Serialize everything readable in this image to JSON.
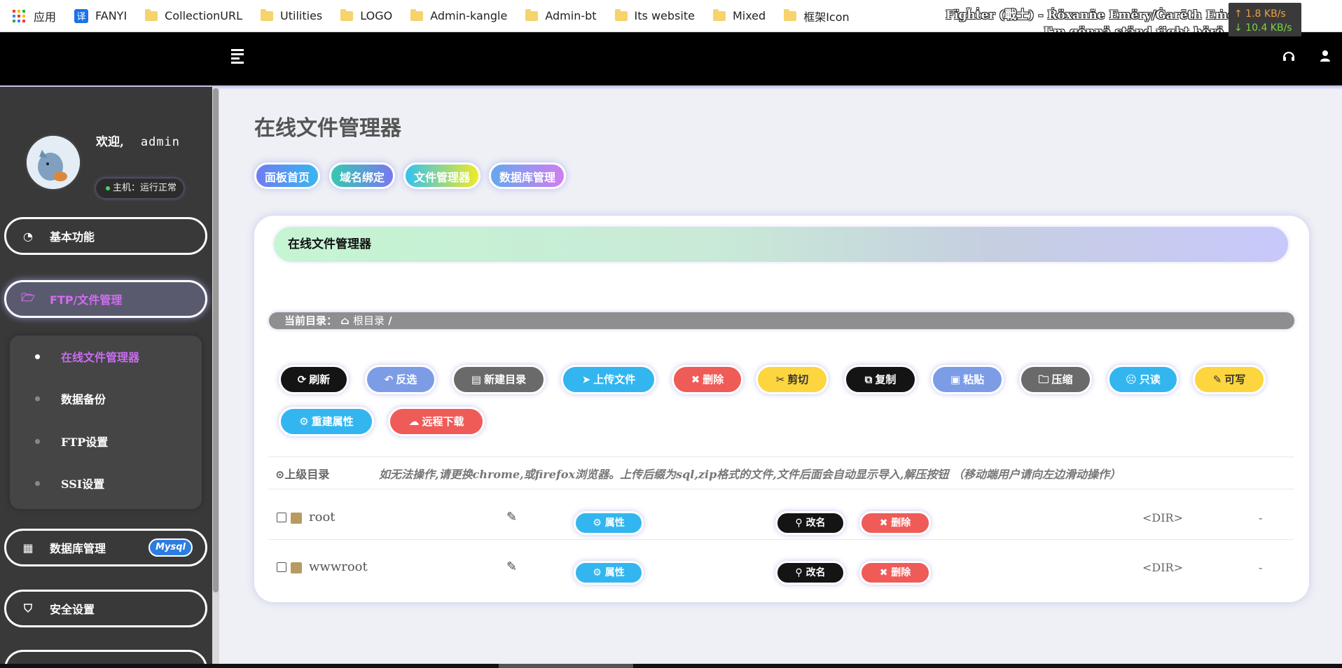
{
  "bookmarks": {
    "apps": "应用",
    "fanyi_icon_char": "译",
    "items": [
      "FANYI",
      "CollectionURL",
      "Utilities",
      "LOGO",
      "Admin-kangle",
      "Admin-bt",
      "Its website",
      "Mixed",
      "框架Icon"
    ]
  },
  "lyrics": {
    "line1": "Fïgh̃ṫer (戰士) - Ŕöxanñe Emëry/Ġarēth Eṁerÿ",
    "line2": "I'm gönnä ständ ŕight hërë"
  },
  "netspeed": {
    "up": "↑ 1.8 KB/s",
    "down": "↓ 10.4 KB/s"
  },
  "header": {
    "menu_icon": "menu-icon",
    "right_icons": [
      "headset-icon",
      "user-icon"
    ]
  },
  "sidebar": {
    "welcome": "欢迎,",
    "username": "admin",
    "host_status": "主机：运行正常",
    "nav": [
      {
        "label": "基本功能",
        "icon": "dashboard-icon"
      },
      {
        "label": "FTP/文件管理",
        "icon": "folder-open-icon"
      },
      {
        "label": "数据库管理",
        "icon": "table-icon",
        "badge": "Mysql"
      },
      {
        "label": "安全设置",
        "icon": "shield-icon"
      }
    ],
    "submenu": [
      "在线文件管理器",
      "数据备份",
      "FTP设置",
      "SSI设置"
    ]
  },
  "main": {
    "title": "在线文件管理器",
    "tabs": [
      "面板首页",
      "域名绑定",
      "文件管理器",
      "数据库管理"
    ],
    "card_title": "在线文件管理器",
    "crumb_label": "当前目录：",
    "crumb_root": "根目录",
    "crumb_sep": "/",
    "toolbar": [
      "刷新",
      "反选",
      "新建目录",
      "上传文件",
      "删除",
      "剪切",
      "复制",
      "粘贴",
      "压缩",
      "只读",
      "可写",
      "重建属性",
      "远程下载"
    ],
    "parent_dir": "上级目录",
    "notice": "如无法操作,请更换chrome,或firefox浏览器。上传后缀为sql,zip格式的文件,文件后面会自动显示导入,解压按钮 （移动端用户请向左边滑动操作）",
    "files": [
      {
        "name": "root",
        "attr": "属性",
        "rename": "改名",
        "delete": "删除",
        "type": "<DIR>",
        "size": "-"
      },
      {
        "name": "wwwroot",
        "attr": "属性",
        "rename": "改名",
        "delete": "删除",
        "type": "<DIR>",
        "size": "-"
      }
    ]
  },
  "colors": {
    "black_btn": "#141414",
    "blue_btn": "#7c9de6",
    "grey_btn": "#6a6a6a",
    "cyan_btn": "#33b6ef",
    "red_btn": "#ef5b57",
    "yellow_btn": "#fcd53f",
    "active_purple": "#d26cf0"
  }
}
